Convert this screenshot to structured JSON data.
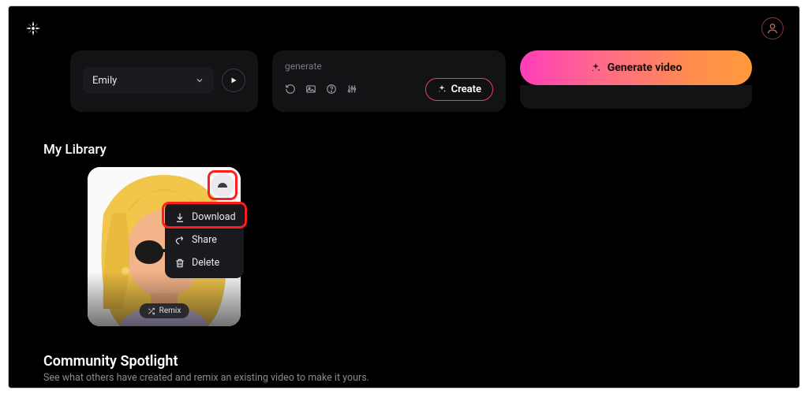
{
  "top": {
    "voice_select": "Emily",
    "generate_hint": "generate",
    "create_label": "Create",
    "generate_video_label": "Generate video"
  },
  "library": {
    "title": "My Library",
    "remix_label": "Remix",
    "menu": {
      "download": "Download",
      "share": "Share",
      "delete": "Delete"
    }
  },
  "community": {
    "title": "Community Spotlight",
    "subtitle": "See what others have created and remix an existing video to make it yours."
  }
}
